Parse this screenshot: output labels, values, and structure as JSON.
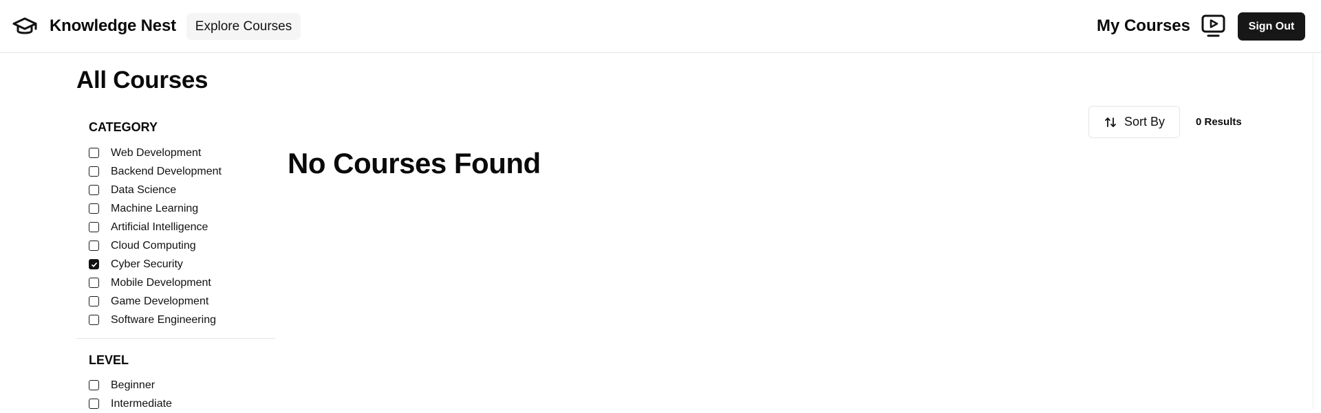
{
  "header": {
    "brand_name": "Knowledge Nest",
    "brand_icon": "graduation-cap-icon",
    "explore_label": "Explore Courses",
    "my_courses_label": "My Courses",
    "my_courses_icon": "video-player-icon",
    "sign_out_label": "Sign Out"
  },
  "page": {
    "title": "All Courses"
  },
  "filters": {
    "category": {
      "heading": "CATEGORY",
      "options": [
        {
          "label": "Web Development",
          "checked": false
        },
        {
          "label": "Backend Development",
          "checked": false
        },
        {
          "label": "Data Science",
          "checked": false
        },
        {
          "label": "Machine Learning",
          "checked": false
        },
        {
          "label": "Artificial Intelligence",
          "checked": false
        },
        {
          "label": "Cloud Computing",
          "checked": false
        },
        {
          "label": "Cyber Security",
          "checked": true
        },
        {
          "label": "Mobile Development",
          "checked": false
        },
        {
          "label": "Game Development",
          "checked": false
        },
        {
          "label": "Software Engineering",
          "checked": false
        }
      ]
    },
    "level": {
      "heading": "LEVEL",
      "options": [
        {
          "label": "Beginner",
          "checked": false
        },
        {
          "label": "Intermediate",
          "checked": false
        }
      ]
    }
  },
  "results": {
    "sort_label": "Sort By",
    "sort_icon": "sort-arrows-icon",
    "count_label": "0 Results",
    "empty_message": "No Courses Found"
  },
  "colors": {
    "primary": "#171717",
    "muted_bg": "#f5f5f5",
    "border": "#e5e5e5"
  }
}
